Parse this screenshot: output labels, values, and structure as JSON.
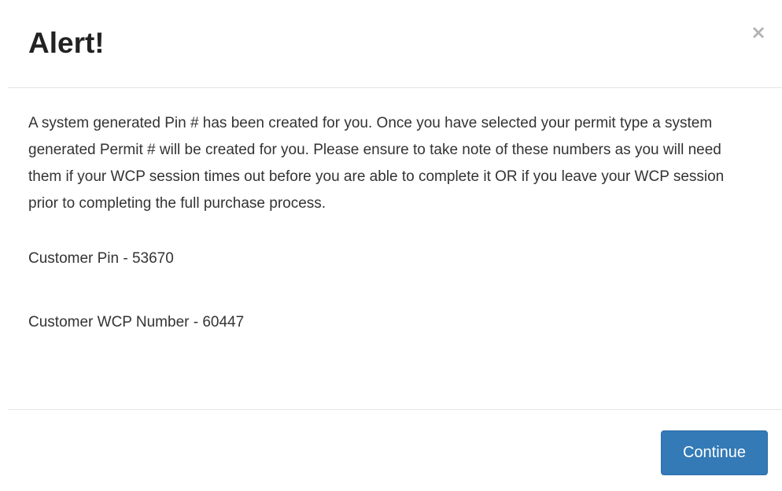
{
  "header": {
    "title": "Alert!",
    "close_label": "×"
  },
  "body": {
    "message": "A system generated Pin # has been created for you. Once you have selected your permit type a system generated Permit # will be created for you. Please ensure to take note of these numbers as you will need them if your WCP session times out before you are able to complete it OR if you leave your WCP session prior to completing the full purchase process.",
    "customer_pin": "Customer Pin - 53670",
    "customer_wcp_number": "Customer WCP Number - 60447"
  },
  "footer": {
    "continue_label": "Continue"
  },
  "colors": {
    "primary_button": "#337ab7",
    "divider": "#e5e5e5",
    "text": "#333333"
  }
}
